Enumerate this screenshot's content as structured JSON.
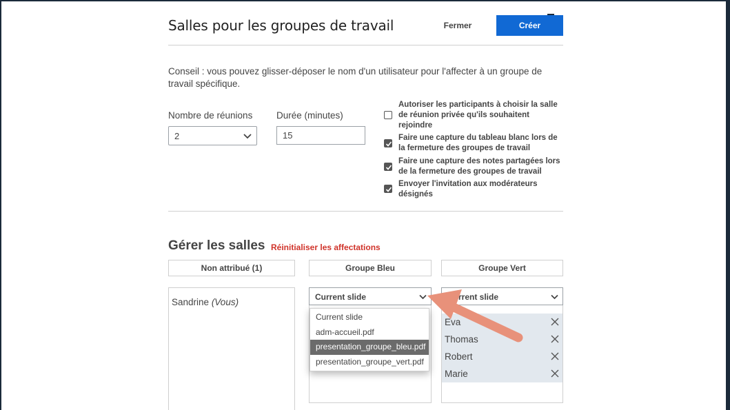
{
  "header": {
    "title": "Salles pour les groupes de travail",
    "close_label": "Fermer",
    "create_label": "Créer"
  },
  "tip": "Conseil : vous pouvez glisser-déposer le nom d'un utilisateur pour l'affecter à un groupe de travail spécifique.",
  "settings": {
    "meetings_label": "Nombre de réunions",
    "meetings_value": "2",
    "duration_label": "Durée (minutes)",
    "duration_value": "15"
  },
  "options": [
    {
      "label": "Autoriser les participants à choisir la salle de réunion privée qu'ils souhaitent rejoindre",
      "checked": false
    },
    {
      "label": "Faire une capture du tableau blanc lors de la fermeture des groupes de travail",
      "checked": true
    },
    {
      "label": "Faire une capture des notes partagées lors de la fermeture des groupes de travail",
      "checked": true
    },
    {
      "label": "Envoyer l'invitation aux modérateurs désignés",
      "checked": true
    }
  ],
  "manage": {
    "title": "Gérer les salles",
    "reset_label": "Réinitialiser les affectations"
  },
  "columns": {
    "unassigned": {
      "header": "Non attribué (1)",
      "user_name": "Sandrine",
      "user_suffix": "(Vous)"
    },
    "blue": {
      "header": "Groupe Bleu",
      "doc_value": "Current slide",
      "dropdown_items": [
        "Current slide",
        "adm-accueil.pdf",
        "presentation_groupe_bleu.pdf",
        "presentation_groupe_vert.pdf"
      ],
      "dropdown_selected_index": 2
    },
    "green": {
      "header": "Groupe Vert",
      "doc_value": "Current slide",
      "members": [
        "Eva",
        "Thomas",
        "Robert",
        "Marie"
      ]
    }
  },
  "colors": {
    "primary": "#1169d4",
    "danger": "#d0332a",
    "arrow": "#e8917a",
    "member_bg": "#e2e8ee",
    "selected_item_bg": "#6b6b6b"
  },
  "icons": {
    "chevron": "chevron-down-icon",
    "remove": "close-icon",
    "check": "check-icon"
  }
}
